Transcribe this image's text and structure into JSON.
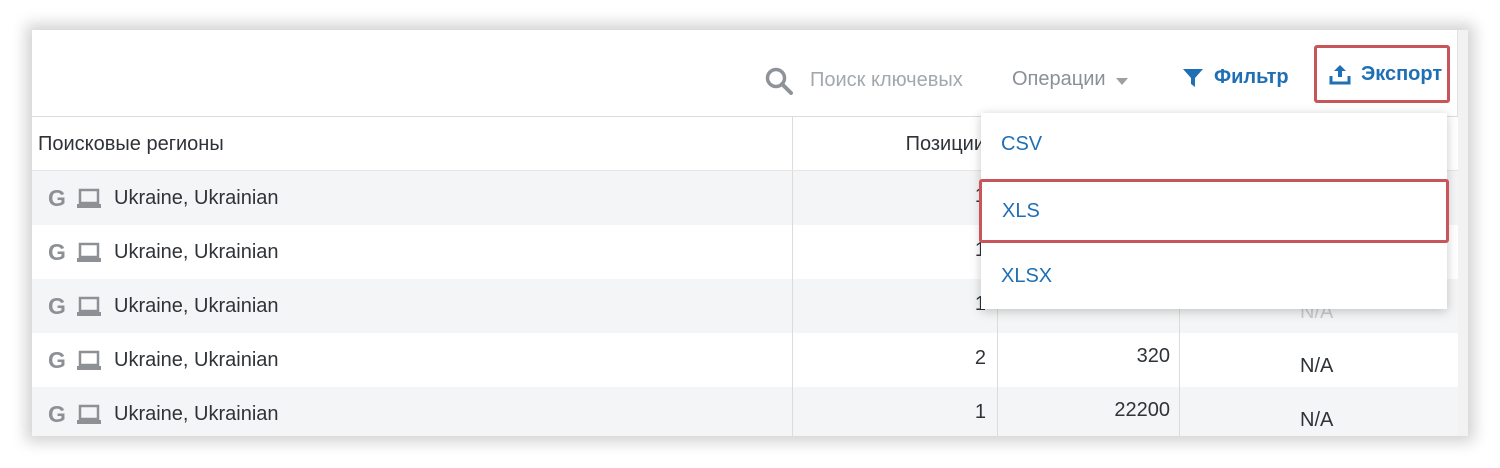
{
  "toolbar": {
    "search_placeholder": "Поиск ключевых",
    "operations_label": "Операции",
    "filter_label": "Фильтр",
    "export_label": "Экспорт"
  },
  "table": {
    "columns": {
      "region": "Поисковые регионы",
      "position": "Позиции"
    },
    "rows": [
      {
        "engine_icon": "google-icon",
        "device_icon": "laptop-icon",
        "region": "Ukraine, Ukrainian",
        "position": "1",
        "volume": "",
        "extra": ""
      },
      {
        "engine_icon": "google-icon",
        "device_icon": "laptop-icon",
        "region": "Ukraine, Ukrainian",
        "position": "1",
        "volume": "",
        "extra": ""
      },
      {
        "engine_icon": "google-icon",
        "device_icon": "laptop-icon",
        "region": "Ukraine, Ukrainian",
        "position": "1",
        "volume": "",
        "extra": "N/A"
      },
      {
        "engine_icon": "google-icon",
        "device_icon": "laptop-icon",
        "region": "Ukraine, Ukrainian",
        "position": "2",
        "volume": "320",
        "extra": "N/A"
      },
      {
        "engine_icon": "google-icon",
        "device_icon": "laptop-icon",
        "region": "Ukraine, Ukrainian",
        "position": "1",
        "volume": "22200",
        "extra": "N/A"
      }
    ]
  },
  "export_menu": {
    "items": [
      "CSV",
      "XLS",
      "XLSX"
    ],
    "selected": "XLS"
  },
  "colors": {
    "accent": "#1f6fb5",
    "highlight": "#c8555a",
    "row_alt": "#f4f5f6"
  }
}
